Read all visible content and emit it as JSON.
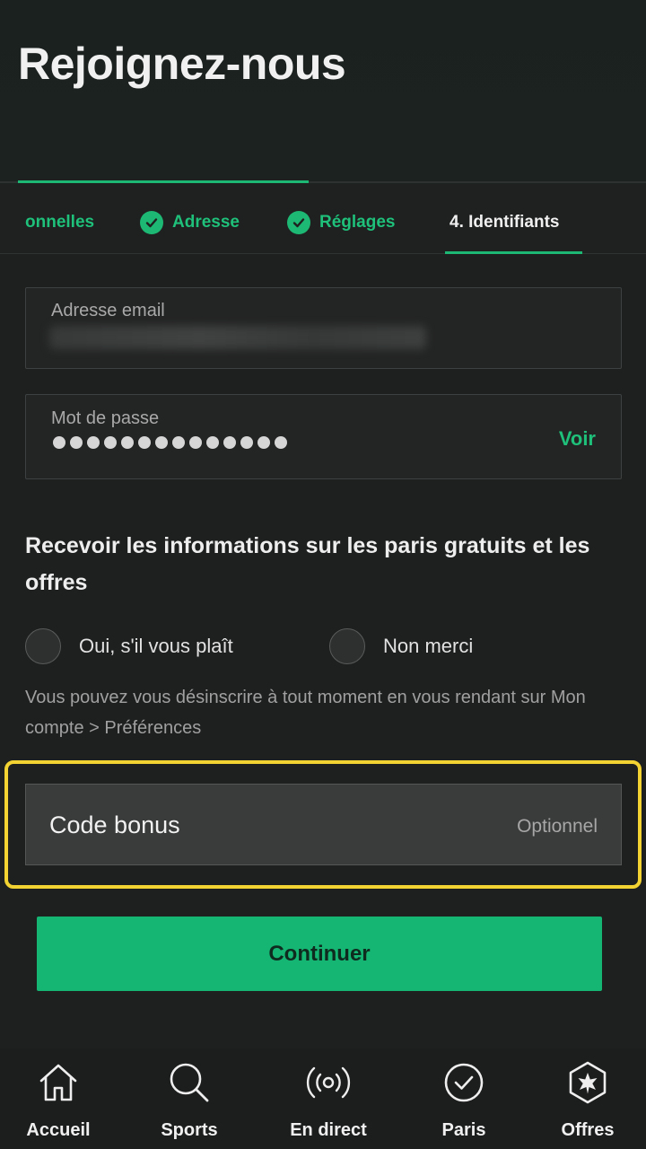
{
  "header": {
    "title": "Rejoignez-nous",
    "progress_percent": 45
  },
  "steps": [
    {
      "label": "onnelles",
      "state": "completed-partial"
    },
    {
      "label": "Adresse",
      "state": "completed"
    },
    {
      "label": "Réglages",
      "state": "completed"
    },
    {
      "label": "4. Identifiants",
      "state": "active"
    }
  ],
  "form": {
    "email": {
      "label": "Adresse email",
      "value": ""
    },
    "password": {
      "label": "Mot de passe",
      "masked_length": 14,
      "toggle_label": "Voir"
    },
    "marketing": {
      "title": "Recevoir les informations sur les paris gratuits et les offres",
      "option_yes": "Oui, s'il vous plaît",
      "option_no": "Non merci",
      "hint": "Vous pouvez vous désinscrire à tout moment en vous rendant sur Mon compte > Préférences"
    },
    "bonus": {
      "label": "Code bonus",
      "optional_label": "Optionnel"
    },
    "continue_label": "Continuer"
  },
  "nav": {
    "items": [
      {
        "label": "Accueil",
        "icon": "home-icon"
      },
      {
        "label": "Sports",
        "icon": "search-icon"
      },
      {
        "label": "En direct",
        "icon": "live-broadcast-icon"
      },
      {
        "label": "Paris",
        "icon": "check-circle-icon"
      },
      {
        "label": "Offres",
        "icon": "star-badge-icon"
      }
    ]
  },
  "colors": {
    "accent": "#1db873",
    "highlight": "#f3d332",
    "background": "#1e1f1f"
  }
}
